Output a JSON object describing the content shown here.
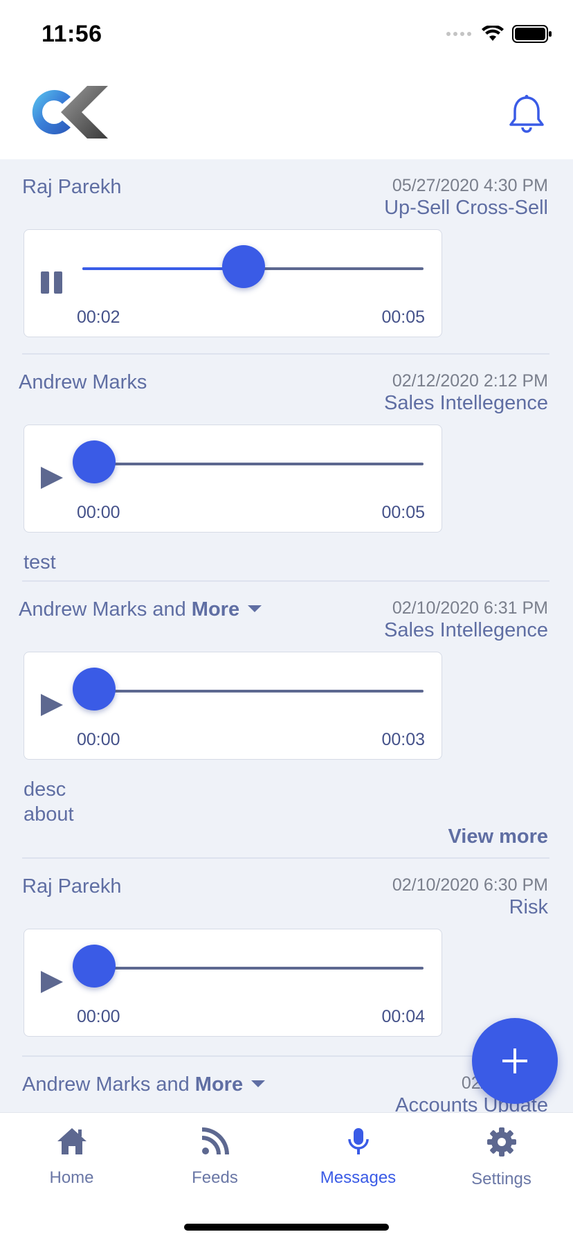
{
  "status_bar": {
    "time": "11:56"
  },
  "header": {
    "logo_icon": "cx-logo-icon",
    "notification_icon": "bell-icon"
  },
  "feed": [
    {
      "sender": "Raj Parekh",
      "more": "",
      "date": "05/27/2020 4:30 PM",
      "category": "Up-Sell Cross-Sell",
      "player": {
        "state": "playing",
        "current": "00:02",
        "total": "00:05",
        "progress": 0.47
      },
      "description": []
    },
    {
      "sender": "Andrew Marks",
      "more": "",
      "date": "02/12/2020 2:12 PM",
      "category": "Sales Intellegence",
      "player": {
        "state": "paused",
        "current": "00:00",
        "total": "00:05",
        "progress": 0
      },
      "description": [
        "test"
      ]
    },
    {
      "sender": "Andrew Marks and",
      "more": "More",
      "date": "02/10/2020 6:31 PM",
      "category": "Sales Intellegence",
      "player": {
        "state": "paused",
        "current": "00:00",
        "total": "00:03",
        "progress": 0
      },
      "description": [
        "desc",
        "about"
      ],
      "view_more": "View more"
    },
    {
      "sender": "Raj Parekh",
      "more": "",
      "date": "02/10/2020 6:30 PM",
      "category": "Risk",
      "player": {
        "state": "paused",
        "current": "00:00",
        "total": "00:04",
        "progress": 0
      },
      "description": []
    },
    {
      "sender": "Andrew Marks and",
      "more": "More",
      "date": "02/10/2020",
      "category": "Accounts Update"
    }
  ],
  "fab": {
    "icon": "plus-icon"
  },
  "tabbar": {
    "tabs": [
      {
        "label": "Home",
        "icon": "home-icon",
        "active": false
      },
      {
        "label": "Feeds",
        "icon": "rss-icon",
        "active": false
      },
      {
        "label": "Messages",
        "icon": "microphone-icon",
        "active": true
      },
      {
        "label": "Settings",
        "icon": "gear-icon",
        "active": false
      }
    ]
  },
  "colors": {
    "accent": "#3a5be6",
    "text": "#5f6ea3",
    "feed_bg": "#eff2f8"
  }
}
